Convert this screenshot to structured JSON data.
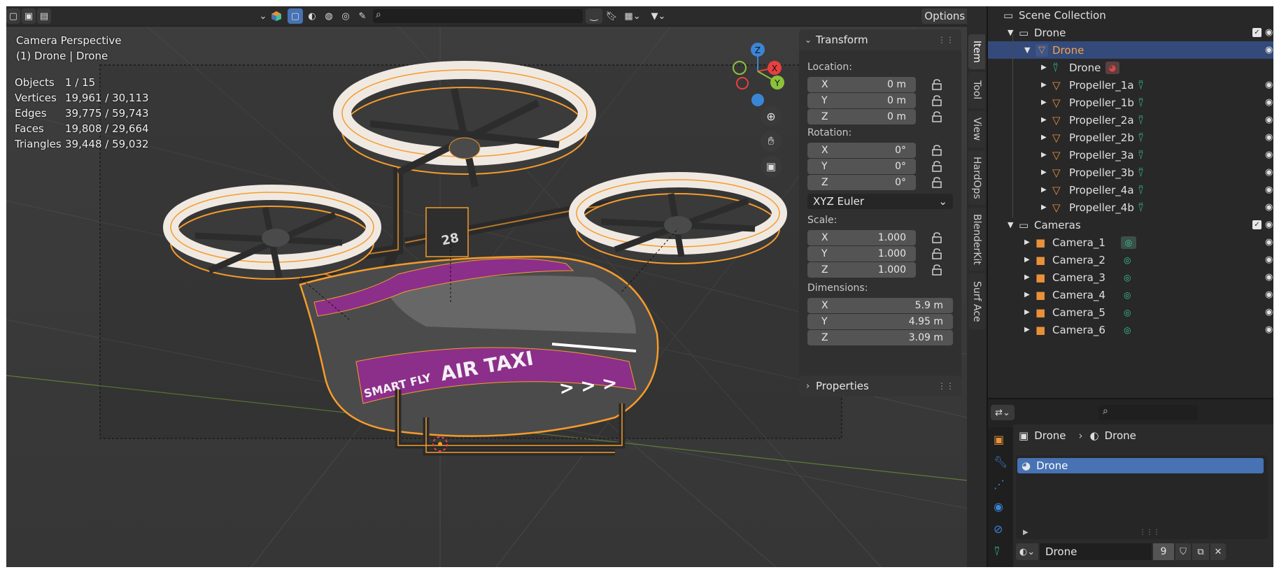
{
  "viewport": {
    "overlay_title": "Camera Perspective",
    "overlay_subtitle": "(1) Drone | Drone",
    "options_label": "Options",
    "stats": [
      {
        "label": "Objects",
        "value": "1 / 15"
      },
      {
        "label": "Vertices",
        "value": "19,961 / 30,113"
      },
      {
        "label": "Edges",
        "value": "39,775 / 59,743"
      },
      {
        "label": "Faces",
        "value": "19,808 / 29,664"
      },
      {
        "label": "Triangles",
        "value": "39,448 / 59,032"
      }
    ],
    "gizmo": {
      "z": "Z",
      "x": "X",
      "y": "Y"
    },
    "model_texts": {
      "livery": "AIR TAXI",
      "brand": "SMART FLY",
      "number": "28",
      "arrows": "> > >"
    }
  },
  "npanel": {
    "transform_title": "Transform",
    "location_label": "Location:",
    "location": [
      {
        "axis": "X",
        "value": "0 m"
      },
      {
        "axis": "Y",
        "value": "0 m"
      },
      {
        "axis": "Z",
        "value": "0 m"
      }
    ],
    "rotation_label": "Rotation:",
    "rotation": [
      {
        "axis": "X",
        "value": "0°"
      },
      {
        "axis": "Y",
        "value": "0°"
      },
      {
        "axis": "Z",
        "value": "0°"
      }
    ],
    "rotation_mode": "XYZ Euler",
    "scale_label": "Scale:",
    "scale": [
      {
        "axis": "X",
        "value": "1.000"
      },
      {
        "axis": "Y",
        "value": "1.000"
      },
      {
        "axis": "Z",
        "value": "1.000"
      }
    ],
    "dimensions_label": "Dimensions:",
    "dimensions": [
      {
        "axis": "X",
        "value": "5.9 m"
      },
      {
        "axis": "Y",
        "value": "4.95 m"
      },
      {
        "axis": "Z",
        "value": "3.09 m"
      }
    ],
    "properties_title": "Properties",
    "tabs": [
      "Item",
      "Tool",
      "View",
      "HardOps",
      "BlenderKit",
      "Surf Ace"
    ]
  },
  "outliner": {
    "root": "Scene Collection",
    "rows": [
      {
        "label": "Drone",
        "kind": "collection"
      },
      {
        "label": "Drone",
        "kind": "object",
        "selected": true
      },
      {
        "label": "Drone",
        "kind": "mesh"
      },
      {
        "label": "Propeller_1a",
        "kind": "object"
      },
      {
        "label": "Propeller_1b",
        "kind": "object"
      },
      {
        "label": "Propeller_2a",
        "kind": "object"
      },
      {
        "label": "Propeller_2b",
        "kind": "object"
      },
      {
        "label": "Propeller_3a",
        "kind": "object"
      },
      {
        "label": "Propeller_3b",
        "kind": "object"
      },
      {
        "label": "Propeller_4a",
        "kind": "object"
      },
      {
        "label": "Propeller_4b",
        "kind": "object"
      },
      {
        "label": "Cameras",
        "kind": "collection"
      },
      {
        "label": "Camera_1",
        "kind": "camera"
      },
      {
        "label": "Camera_2",
        "kind": "camera"
      },
      {
        "label": "Camera_3",
        "kind": "camera"
      },
      {
        "label": "Camera_4",
        "kind": "camera"
      },
      {
        "label": "Camera_5",
        "kind": "camera"
      },
      {
        "label": "Camera_6",
        "kind": "camera"
      }
    ]
  },
  "properties": {
    "breadcrumb_object": "Drone",
    "breadcrumb_material": "Drone",
    "material_slot": "Drone",
    "material_name": "Drone",
    "user_count": "9"
  },
  "colors": {
    "selection": "#f59c2b",
    "accent_blue": "#4772b3",
    "object_orange": "#e8913a",
    "mesh_green": "#37c79a",
    "axis_x": "#e8403e",
    "axis_y": "#8bc23a",
    "axis_z": "#3a85d6"
  }
}
